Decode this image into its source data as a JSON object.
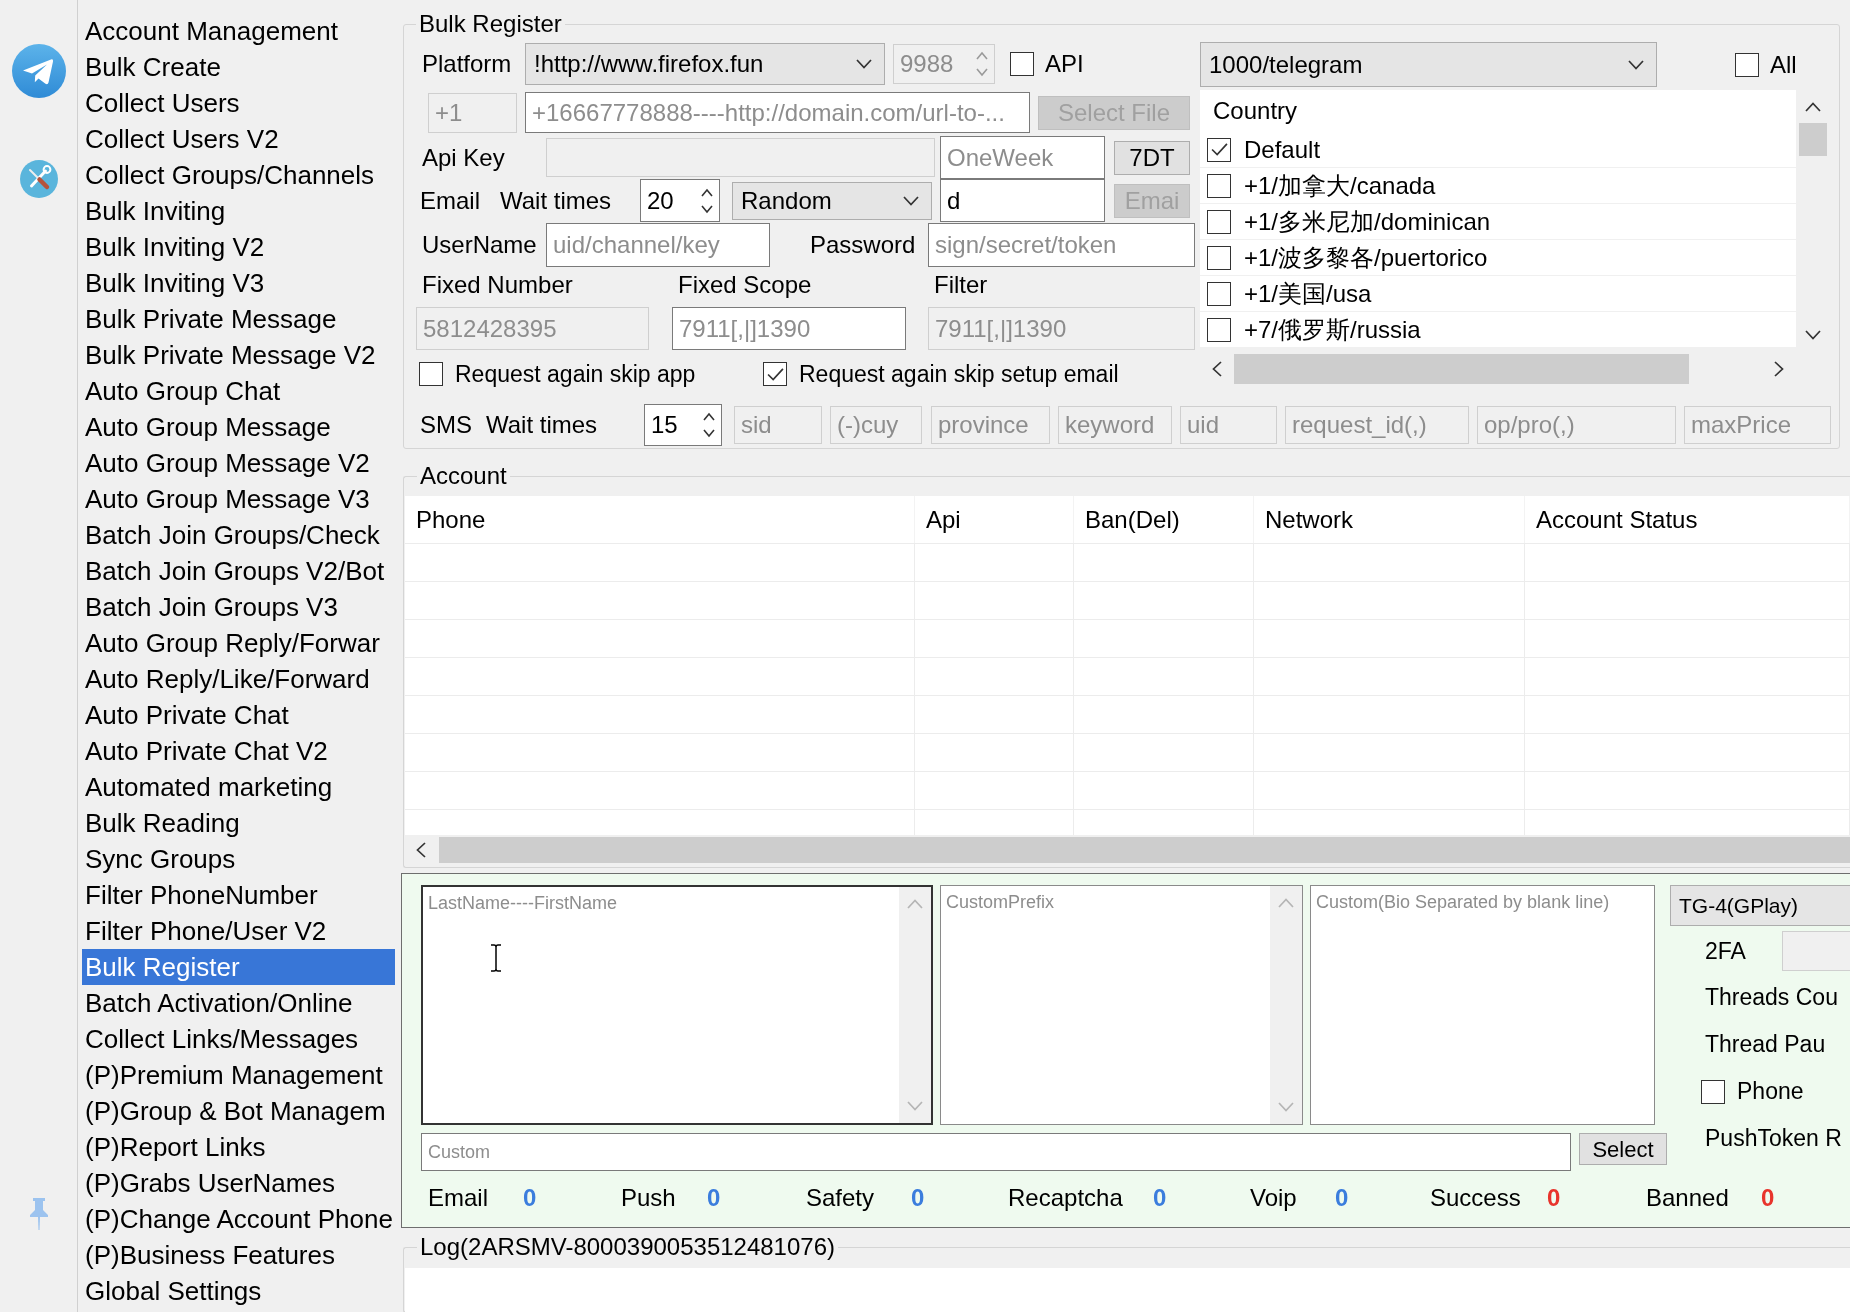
{
  "sidebar": {
    "items": [
      {
        "label": "Account Management",
        "selected": false
      },
      {
        "label": "Bulk Create",
        "selected": false
      },
      {
        "label": "Collect Users",
        "selected": false
      },
      {
        "label": "Collect Users V2",
        "selected": false
      },
      {
        "label": "Collect Groups/Channels",
        "selected": false
      },
      {
        "label": "Bulk Inviting",
        "selected": false
      },
      {
        "label": "Bulk Inviting V2",
        "selected": false
      },
      {
        "label": "Bulk Inviting V3",
        "selected": false
      },
      {
        "label": "Bulk Private Message",
        "selected": false
      },
      {
        "label": "Bulk Private Message V2",
        "selected": false
      },
      {
        "label": "Auto Group Chat",
        "selected": false
      },
      {
        "label": "Auto Group Message",
        "selected": false
      },
      {
        "label": "Auto Group Message V2",
        "selected": false
      },
      {
        "label": "Auto Group Message V3",
        "selected": false
      },
      {
        "label": "Batch Join Groups/Check",
        "selected": false
      },
      {
        "label": "Batch Join Groups V2/Bot",
        "selected": false
      },
      {
        "label": "Batch Join Groups V3",
        "selected": false
      },
      {
        "label": "Auto Group Reply/Forwar",
        "selected": false
      },
      {
        "label": "Auto Reply/Like/Forward",
        "selected": false
      },
      {
        "label": "Auto Private Chat",
        "selected": false
      },
      {
        "label": "Auto Private Chat V2",
        "selected": false
      },
      {
        "label": "Automated marketing",
        "selected": false
      },
      {
        "label": "Bulk Reading",
        "selected": false
      },
      {
        "label": "Sync Groups",
        "selected": false
      },
      {
        "label": "Filter PhoneNumber",
        "selected": false
      },
      {
        "label": "Filter Phone/User V2",
        "selected": false
      },
      {
        "label": "Bulk Register",
        "selected": true
      },
      {
        "label": "Batch Activation/Online",
        "selected": false
      },
      {
        "label": "Collect Links/Messages",
        "selected": false
      },
      {
        "label": "(P)Premium Management",
        "selected": false
      },
      {
        "label": "(P)Group & Bot Managem",
        "selected": false
      },
      {
        "label": "(P)Report Links",
        "selected": false
      },
      {
        "label": "(P)Grabs UserNames",
        "selected": false
      },
      {
        "label": "(P)Change Account Phone",
        "selected": false
      },
      {
        "label": "(P)Business Features",
        "selected": false
      },
      {
        "label": "Global Settings",
        "selected": false
      }
    ]
  },
  "bulk_register": {
    "title": "Bulk Register",
    "platform": {
      "label": "Platform",
      "value": "!http://www.firefox.fun"
    },
    "port": {
      "value": "9988",
      "disabled": true
    },
    "api_checkbox": {
      "label": "API",
      "checked": false
    },
    "country_code": {
      "placeholder": "+1",
      "disabled": true
    },
    "number_source": {
      "placeholder": "+16667778888----http://domain.com/url-to-...",
      "disabled": false
    },
    "select_file": {
      "label": "Select File",
      "disabled": true
    },
    "api_key": {
      "label": "Api Key",
      "disabled": true
    },
    "duration": {
      "placeholder": "OneWeek",
      "disabled": false
    },
    "duration_button": {
      "label": "7DT",
      "disabled": false
    },
    "email": {
      "label": "Email",
      "wait_label": "Wait times",
      "wait": {
        "value": "20",
        "disabled": false
      },
      "mode": "Random",
      "address": {
        "value": "d",
        "disabled": false
      },
      "button": {
        "label": "Emai",
        "disabled": true
      }
    },
    "username": {
      "label": "UserName",
      "placeholder": "uid/channel/key",
      "disabled": false
    },
    "password": {
      "label": "Password",
      "placeholder": "sign/secret/token",
      "disabled": false
    },
    "fixed_number": {
      "label": "Fixed Number",
      "placeholder": "5812428395",
      "disabled": true
    },
    "fixed_scope": {
      "label": "Fixed Scope",
      "placeholder": "7911[,|]1390",
      "disabled": false
    },
    "filter": {
      "label": "Filter",
      "placeholder": "7911[,|]1390",
      "disabled": true
    },
    "options": [
      {
        "label": "Request again skip app",
        "checked": false
      },
      {
        "label": "Request again skip setup email",
        "checked": true
      }
    ],
    "service": "1000/telegram",
    "all_checkbox": {
      "label": "All",
      "checked": false
    },
    "countries": {
      "header": "Country",
      "items": [
        {
          "label": "Default",
          "checked": true
        },
        {
          "label": "+1/加拿大/canada",
          "checked": false
        },
        {
          "label": "+1/多米尼加/dominican",
          "checked": false
        },
        {
          "label": "+1/波多黎各/puertorico",
          "checked": false
        },
        {
          "label": "+1/美国/usa",
          "checked": false
        },
        {
          "label": "+7/俄罗斯/russia",
          "checked": false
        }
      ]
    },
    "sms": {
      "label": "SMS",
      "wait_label": "Wait times",
      "wait": {
        "value": "15",
        "disabled": false
      },
      "fields": [
        {
          "placeholder": "sid",
          "disabled": true
        },
        {
          "placeholder": "(-)cuy",
          "disabled": true
        },
        {
          "placeholder": "province",
          "disabled": true
        },
        {
          "placeholder": "keyword",
          "disabled": true
        },
        {
          "placeholder": "uid",
          "disabled": true
        },
        {
          "placeholder": "request_id(,)",
          "disabled": true
        },
        {
          "placeholder": "op/pro(,)",
          "disabled": true
        },
        {
          "placeholder": "maxPrice",
          "disabled": true
        }
      ]
    }
  },
  "account": {
    "title": "Account",
    "columns": [
      "Phone",
      "Api",
      "Ban(Del)",
      "Network",
      "Account Status"
    ]
  },
  "register_panel": {
    "names": {
      "placeholder": "LastName----FirstName"
    },
    "prefix": {
      "placeholder": "CustomPrefix"
    },
    "bio": {
      "placeholder": "Custom(Bio Separated by blank line)"
    },
    "custom": {
      "placeholder": "Custom",
      "disabled": false
    },
    "select_button": "Select",
    "client": "TG-4(GPlay)",
    "settings": [
      {
        "kind": "field",
        "label": "2FA"
      },
      {
        "kind": "text",
        "label": "Threads Cou"
      },
      {
        "kind": "text",
        "label": "Thread Pau"
      },
      {
        "kind": "checkbox",
        "label": "Phone",
        "checked": false
      },
      {
        "kind": "text",
        "label": "PushToken R"
      }
    ],
    "stats": [
      {
        "label": "Email",
        "value": "0",
        "color": "#3b7ddd"
      },
      {
        "label": "Push",
        "value": "0",
        "color": "#3b7ddd"
      },
      {
        "label": "Safety",
        "value": "0",
        "color": "#3b7ddd"
      },
      {
        "label": "Recaptcha",
        "value": "0",
        "color": "#3b7ddd"
      },
      {
        "label": "Voip",
        "value": "0",
        "color": "#3b7ddd"
      },
      {
        "label": "Success",
        "value": "0",
        "color": "#e8342c"
      },
      {
        "label": "Banned",
        "value": "0",
        "color": "#e8342c"
      }
    ]
  },
  "log": {
    "title": "Log(2ARSMV-8000390053512481076)"
  }
}
